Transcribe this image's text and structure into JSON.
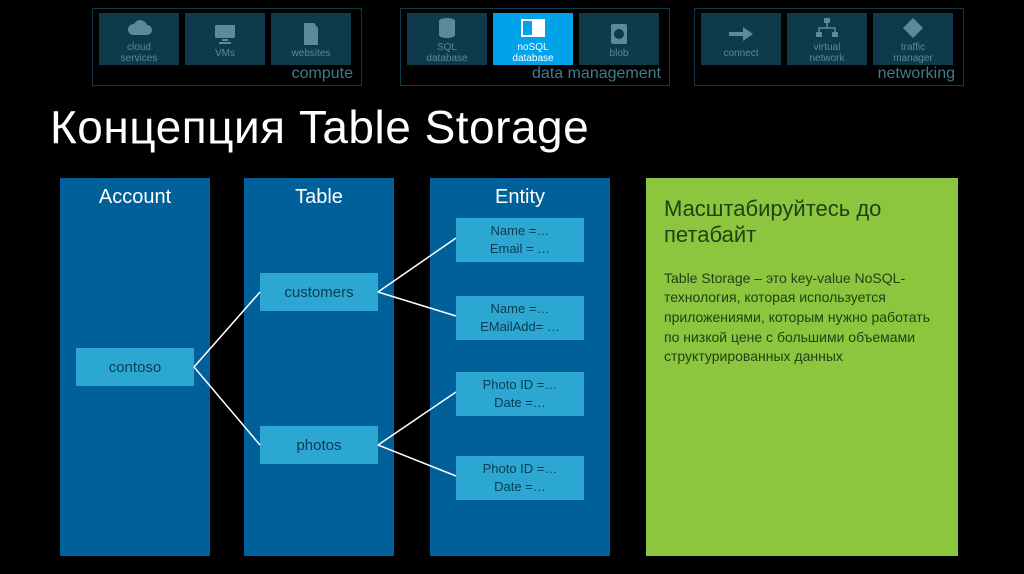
{
  "nav": {
    "groups": [
      {
        "label": "compute",
        "tiles": [
          {
            "name": "cloud-services",
            "label": "cloud\nservices",
            "icon": "cloud"
          },
          {
            "name": "vms",
            "label": "VMs",
            "icon": "monitor"
          },
          {
            "name": "websites",
            "label": "websites",
            "icon": "document"
          }
        ]
      },
      {
        "label": "data management",
        "tiles": [
          {
            "name": "sql-database",
            "label": "SQL\ndatabase",
            "icon": "db"
          },
          {
            "name": "nosql-database",
            "label": "noSQL\ndatabase",
            "icon": "table",
            "active": true
          },
          {
            "name": "blob",
            "label": "blob",
            "icon": "disk"
          }
        ]
      },
      {
        "label": "networking",
        "tiles": [
          {
            "name": "connect",
            "label": "connect",
            "icon": "arrow"
          },
          {
            "name": "virtual-network",
            "label": "virtual\nnetwork",
            "icon": "network"
          },
          {
            "name": "traffic-manager",
            "label": "traffic\nmanager",
            "icon": "diamond"
          }
        ]
      }
    ]
  },
  "title": "Концепция Table Storage",
  "columns": {
    "account": {
      "header": "Account",
      "node": "contoso"
    },
    "table": {
      "header": "Table",
      "nodes": [
        "customers",
        "photos"
      ]
    },
    "entity": {
      "header": "Entity",
      "boxes": [
        {
          "l1": "Name =…",
          "l2": "Email = …"
        },
        {
          "l1": "Name =…",
          "l2": "EMailAdd= …"
        },
        {
          "l1": "Photo ID =…",
          "l2": "Date =…"
        },
        {
          "l1": "Photo ID =…",
          "l2": "Date =…"
        }
      ]
    }
  },
  "info": {
    "title": "Масштабируйтесь до петабайт",
    "body": "Table Storage – это key-value NoSQL-технология, которая используется приложениями, которым нужно работать по низкой цене с большими объемами структурированных данных"
  }
}
